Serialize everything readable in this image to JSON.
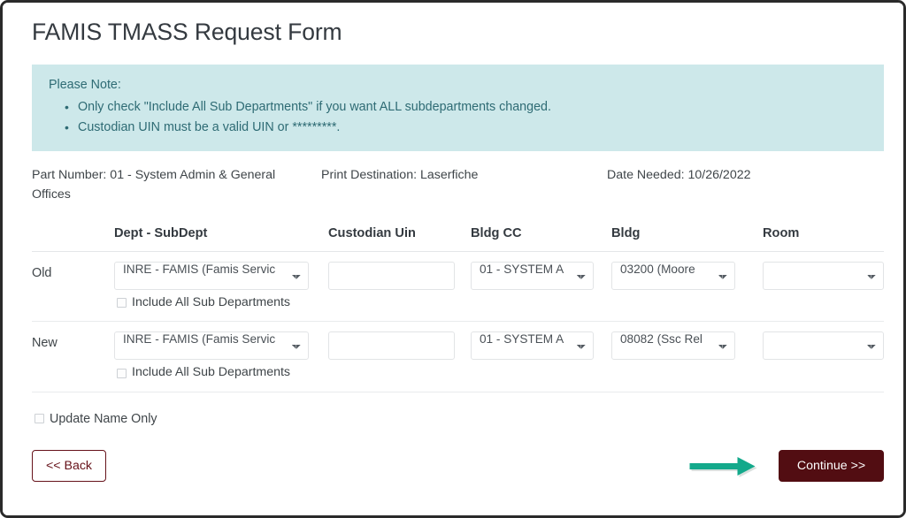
{
  "page": {
    "title": "FAMIS TMASS Request Form"
  },
  "note": {
    "heading": "Please Note:",
    "items": [
      "Only check \"Include All Sub Departments\" if you want ALL subdepartments changed.",
      "Custodian UIN must be a valid UIN or *********."
    ]
  },
  "meta": {
    "part_number": "Part Number: 01 - System Admin & General Offices",
    "print_destination": "Print Destination: Laserfiche",
    "date_needed": "Date Needed: 10/26/2022"
  },
  "table": {
    "headers": {
      "row_label": "",
      "dept_subdept": "Dept - SubDept",
      "custodian_uin": "Custodian Uin",
      "bldg_cc": "Bldg CC",
      "bldg": "Bldg",
      "room": "Room"
    },
    "rows": [
      {
        "label": "Old",
        "dept_subdept_value": "INRE - FAMIS (Famis Servic",
        "custodian_uin_value": "",
        "custodian_uin_placeholder": "",
        "bldg_cc_value": "01 - SYSTEM A",
        "bldg_value": "03200 (Moore",
        "room_value": "",
        "include_all_sub_departments_label": "Include All Sub Departments",
        "include_all_sub_departments_checked": "false"
      },
      {
        "label": "New",
        "dept_subdept_value": "INRE - FAMIS (Famis Servic",
        "custodian_uin_value": "",
        "custodian_uin_placeholder": "",
        "bldg_cc_value": "01 - SYSTEM A",
        "bldg_value": "08082 (Ssc Rel",
        "room_value": "",
        "include_all_sub_departments_label": "Include All Sub Departments",
        "include_all_sub_departments_checked": "false"
      }
    ]
  },
  "options": {
    "update_name_only_label": "Update Name Only",
    "update_name_only_checked": "false"
  },
  "footer": {
    "back_label": "<< Back",
    "continue_label": "Continue >>"
  },
  "annotation": {
    "arrow_icon": "arrow-right-icon",
    "arrow_color": "#13a98b",
    "points_to": "Continue >>"
  },
  "colors": {
    "note_background": "#cde8ea",
    "note_text": "#2e6b74",
    "primary_button": "#520d12",
    "secondary_button_border": "#66121a",
    "title_text": "#343a40",
    "annotation_arrow": "#13a98b"
  }
}
